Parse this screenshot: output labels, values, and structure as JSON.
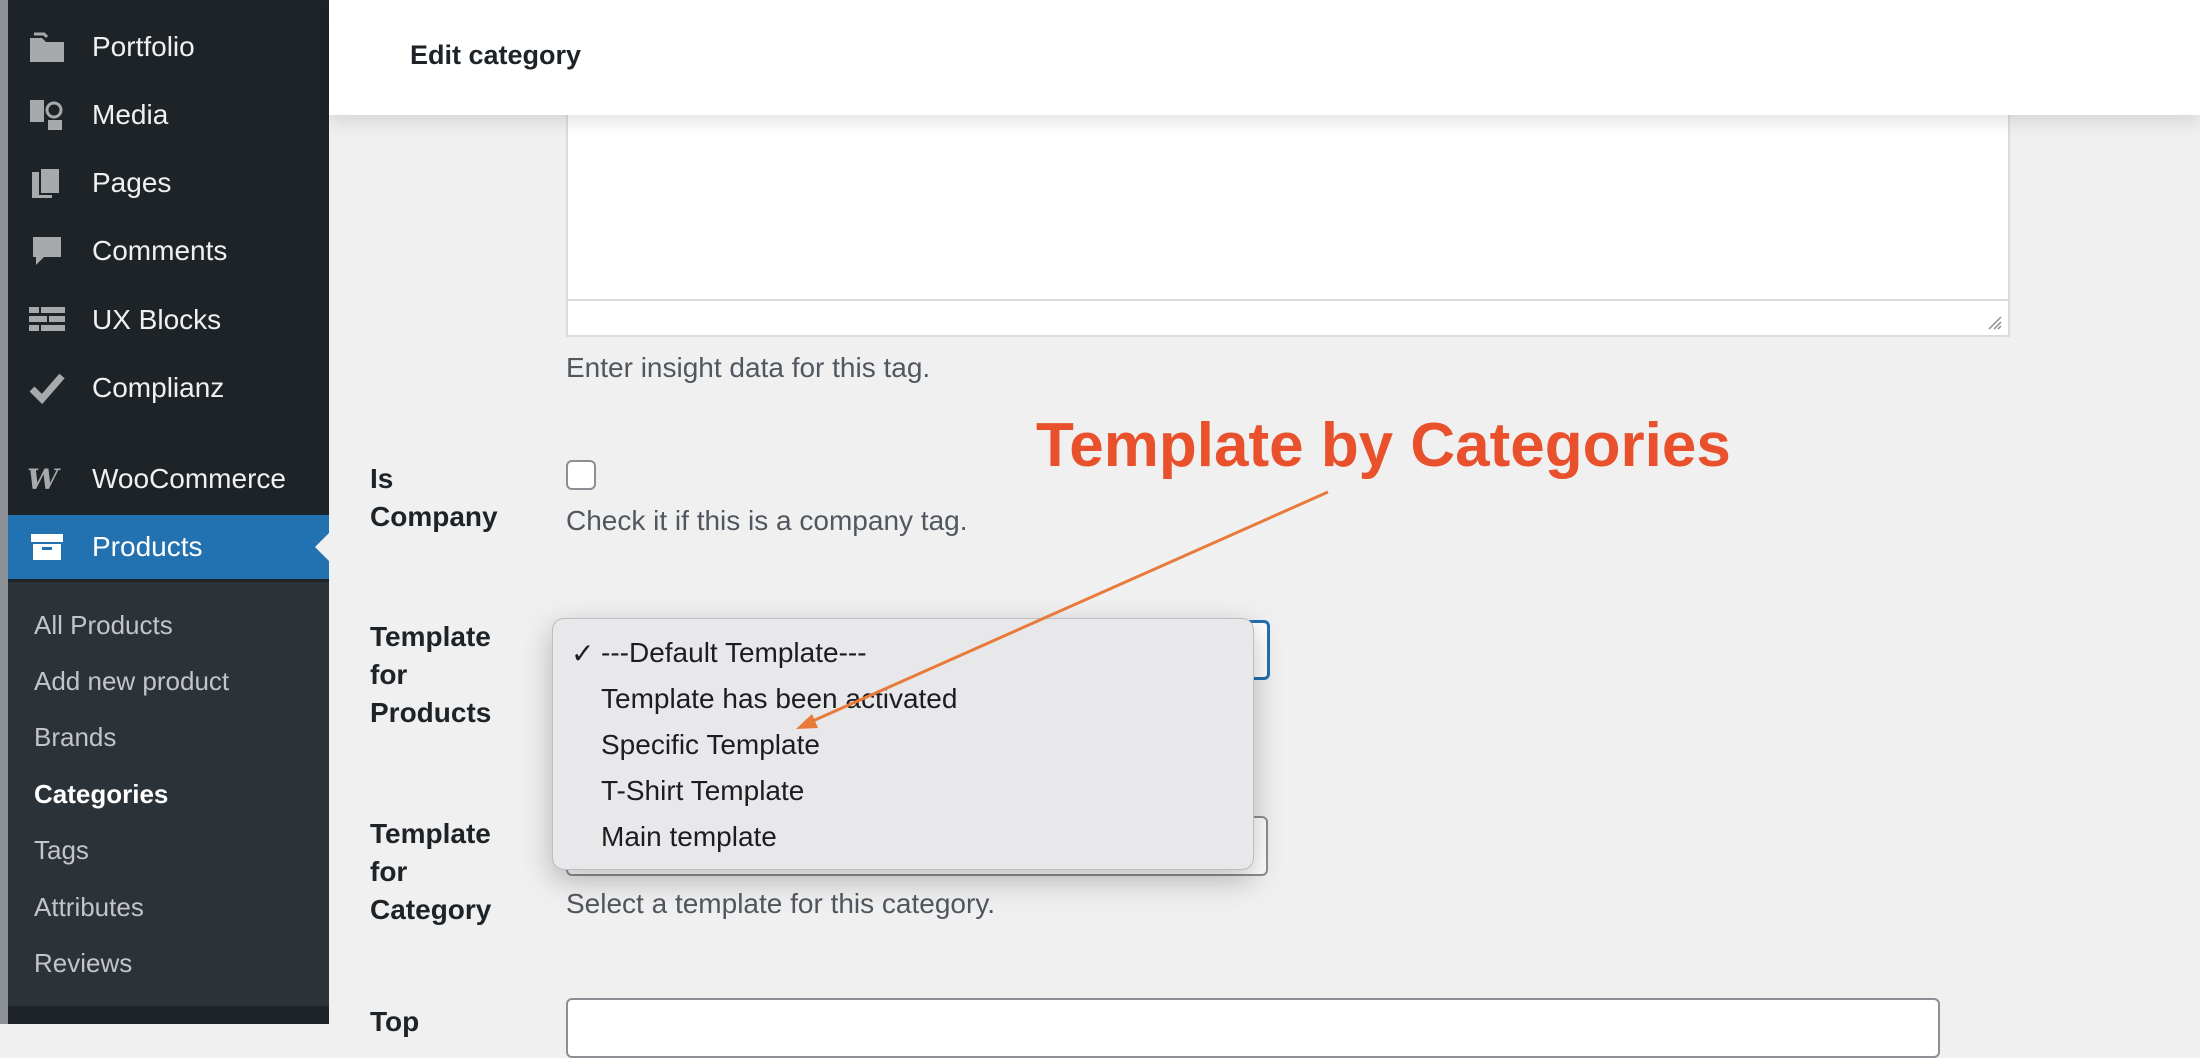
{
  "sidebar": {
    "items": [
      {
        "label": "Portfolio",
        "icon": "portfolio-icon"
      },
      {
        "label": "Media",
        "icon": "media-icon"
      },
      {
        "label": "Pages",
        "icon": "pages-icon"
      },
      {
        "label": "Comments",
        "icon": "comments-icon"
      },
      {
        "label": "UX Blocks",
        "icon": "ux-blocks-icon"
      },
      {
        "label": "Complianz",
        "icon": "checkmark-icon"
      },
      {
        "label": "WooCommerce",
        "icon": "woocommerce-icon"
      },
      {
        "label": "Products",
        "icon": "products-icon",
        "active": true
      }
    ],
    "submenu": [
      {
        "label": "All Products"
      },
      {
        "label": "Add new product"
      },
      {
        "label": "Brands"
      },
      {
        "label": "Categories",
        "current": true
      },
      {
        "label": "Tags"
      },
      {
        "label": "Attributes"
      },
      {
        "label": "Reviews"
      }
    ]
  },
  "header": {
    "title": "Edit category"
  },
  "form": {
    "insight_help": "Enter insight data for this tag.",
    "is_company_label": [
      "Is",
      "Company"
    ],
    "is_company_help": "Check it if this is a company tag.",
    "template_products_label": [
      "Template",
      "for",
      "Products"
    ],
    "template_category_label": [
      "Template",
      "for",
      "Category"
    ],
    "template_category_help": "Select a template for this category.",
    "next_label_partial": "Top"
  },
  "dropdown": {
    "selected": "---Default Template---",
    "options": [
      "---Default Template---",
      "Template has been activated",
      "Specific Template",
      "T-Shirt Template",
      "Main template"
    ]
  },
  "annotation": {
    "text": "Template by Categories",
    "color": "#e8512c"
  },
  "colors": {
    "sidebar_bg": "#1d2327",
    "active": "#2271b1",
    "annotation": "#e8512c",
    "arrow": "#e87a3a"
  }
}
